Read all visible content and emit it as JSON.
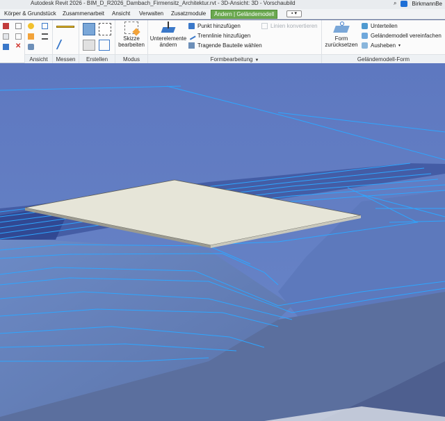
{
  "titlebar": {
    "title": "Autodesk Revit 2026 - BIM_D_R2026_Dambach_Firmensitz_Architektur.rvt - 3D-Ansicht: 3D - Vorschaubild",
    "user": "BirkmannBe"
  },
  "tabs": [
    {
      "label": "Körper & Grundstück"
    },
    {
      "label": "Zusammenarbeit"
    },
    {
      "label": "Ansicht"
    },
    {
      "label": "Verwalten"
    },
    {
      "label": "Zusatzmodule"
    },
    {
      "label": "Ändern | Geländemodell"
    }
  ],
  "ribbon": {
    "groups": {
      "ansicht": "Ansicht",
      "messen": "Messen",
      "erstellen": "Erstellen",
      "modus": "Modus",
      "formbearbeitung": "Formbearbeitung",
      "gelaendemodell_form": "Geländemodell-Form"
    },
    "buttons": {
      "skizze_line1": "Skizze",
      "skizze_line2": "bearbeiten",
      "unterelemente_line1": "Unterelemente",
      "unterelemente_line2": "ändern",
      "punkt_hinzufuegen": "Punkt hinzufügen",
      "trennlinie_hinzufuegen": "Trennlinie hinzufügen",
      "tragende_bauteile": "Tragende Bauteile wählen",
      "linien_konvertieren": "Linien konvertieren",
      "form_line1": "Form",
      "form_line2": "zurücksetzen",
      "unterteilen": "Unterteilen",
      "vereinfachen": "Geländemodell vereinfachen",
      "ausheben": "Ausheben"
    }
  },
  "colors": {
    "active_tab": "#6aa84f",
    "viewport_bg": "#5a6a96",
    "contour": "#2ea6ff",
    "slab_top": "#e6e5d8"
  }
}
